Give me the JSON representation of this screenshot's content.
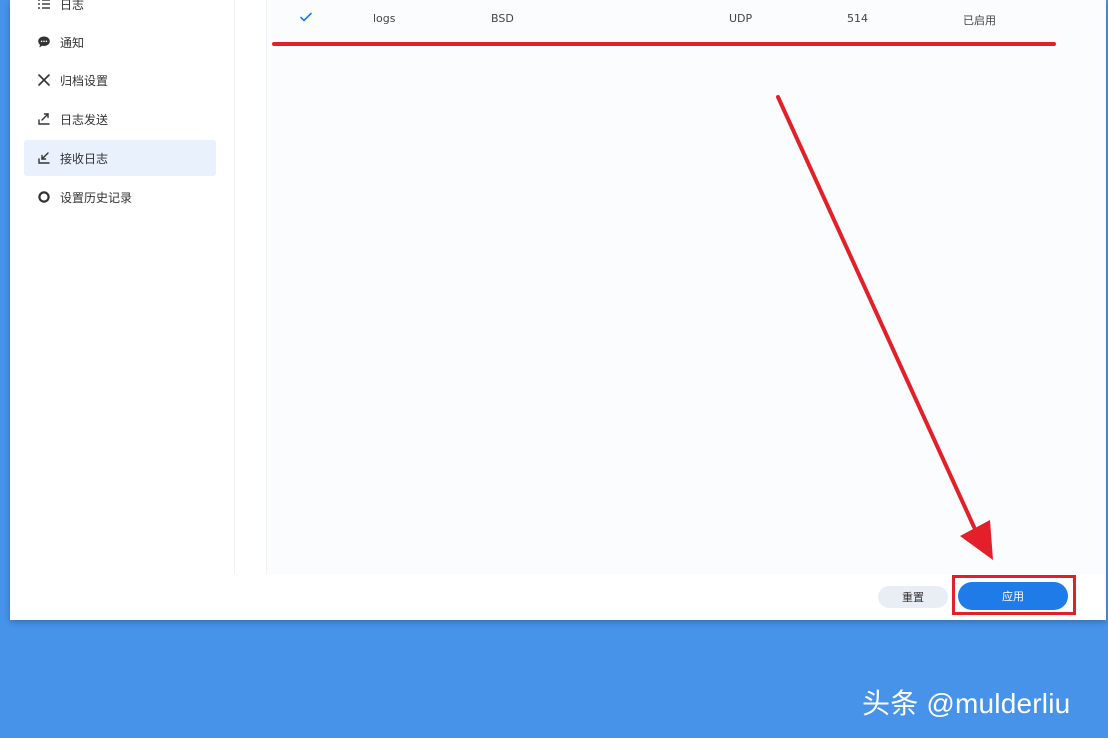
{
  "sidebar": {
    "items": [
      {
        "label": "日志",
        "icon": "list-icon",
        "active": false
      },
      {
        "label": "通知",
        "icon": "chat-bubble-icon",
        "active": false
      },
      {
        "label": "归档设置",
        "icon": "tools-icon",
        "active": false
      },
      {
        "label": "日志发送",
        "icon": "upload-icon",
        "active": false
      },
      {
        "label": "接收日志",
        "icon": "download-icon",
        "active": true
      },
      {
        "label": "设置历史记录",
        "icon": "gear-icon",
        "active": false
      }
    ]
  },
  "table": {
    "rows": [
      {
        "enabled": true,
        "name": "logs",
        "format": "BSD",
        "protocol": "UDP",
        "port": "514",
        "status": "已启用"
      }
    ]
  },
  "footer": {
    "reset_label": "重置",
    "apply_label": "应用"
  },
  "watermark": "头条 @mulderliu",
  "colors": {
    "accent": "#1f7be8",
    "annotation": "#e3202a",
    "desktop": "#4793ea",
    "active_bg": "#e8f1fc"
  }
}
